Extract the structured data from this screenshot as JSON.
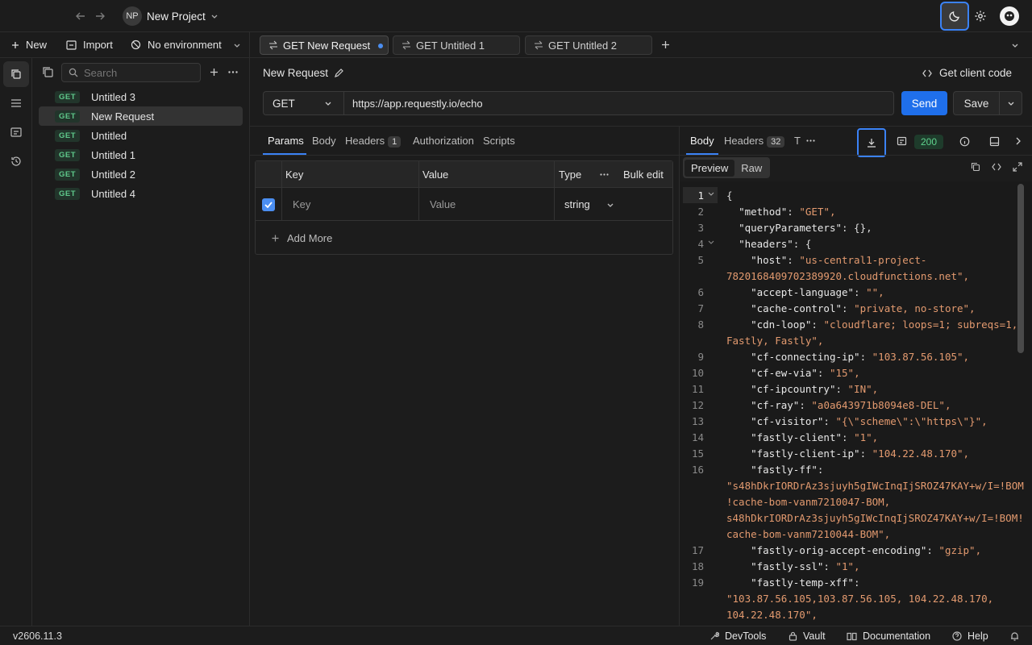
{
  "topbar": {
    "project_initials": "NP",
    "project_name": "New Project"
  },
  "toolbar": {
    "new_label": "New",
    "import_label": "Import",
    "environment_label": "No environment"
  },
  "tabs": [
    {
      "label": "GET New Request",
      "active": true,
      "unsaved": true
    },
    {
      "label": "GET Untitled 1",
      "active": false
    },
    {
      "label": "GET Untitled 2",
      "active": false
    }
  ],
  "sidebar": {
    "search_placeholder": "Search",
    "items": [
      {
        "method": "GET",
        "name": "Untitled 3"
      },
      {
        "method": "GET",
        "name": "New Request",
        "selected": true
      },
      {
        "method": "GET",
        "name": "Untitled"
      },
      {
        "method": "GET",
        "name": "Untitled 1"
      },
      {
        "method": "GET",
        "name": "Untitled 2"
      },
      {
        "method": "GET",
        "name": "Untitled 4"
      }
    ]
  },
  "request": {
    "name": "New Request",
    "client_code_label": "Get client code",
    "method": "GET",
    "url": "https://app.requestly.io/echo",
    "send_label": "Send",
    "save_label": "Save",
    "tabs": {
      "params": "Params",
      "body": "Body",
      "headers": "Headers",
      "headers_count": "1",
      "authorization": "Authorization",
      "scripts": "Scripts"
    },
    "params_table": {
      "col_key": "Key",
      "col_value": "Value",
      "col_type": "Type",
      "bulk_edit": "Bulk edit",
      "row_key_placeholder": "Key",
      "row_value_placeholder": "Value",
      "row_type": "string",
      "add_more": "Add More"
    }
  },
  "response": {
    "tab_body": "Body",
    "tab_headers": "Headers",
    "headers_count": "32",
    "tab_truncated": "T",
    "status": "200",
    "view_preview": "Preview",
    "view_raw": "Raw",
    "lines": [
      {
        "n": "1",
        "text": "{"
      },
      {
        "n": "2",
        "key": "\"method\"",
        "val": "\"GET\","
      },
      {
        "n": "3",
        "key": "\"queryParameters\"",
        "plain": ": {},"
      },
      {
        "n": "4",
        "key": "\"headers\"",
        "plain": ": {"
      },
      {
        "n": "5",
        "key": "\"host\"",
        "val": "\"us-central1-project-",
        "cont": "782016840970238992​0.cloudfunctions.net\","
      },
      {
        "n": "6",
        "key": "\"accept-language\"",
        "val": "\"\","
      },
      {
        "n": "7",
        "key": "\"cache-control\"",
        "val": "\"private, no-store\","
      },
      {
        "n": "8",
        "key": "\"cdn-loop\"",
        "val": "\"cloudflare; loops=1; subreqs=1,",
        "cont": "Fastly, Fastly\","
      },
      {
        "n": "9",
        "key": "\"cf-connecting-ip\"",
        "val": "\"103.87.56.105\","
      },
      {
        "n": "10",
        "key": "\"cf-ew-via\"",
        "val": "\"15\","
      },
      {
        "n": "11",
        "key": "\"cf-ipcountry\"",
        "val": "\"IN\","
      },
      {
        "n": "12",
        "key": "\"cf-ray\"",
        "val": "\"a0a643971b8094e8-DEL\","
      },
      {
        "n": "13",
        "key": "\"cf-visitor\"",
        "val": "\"{\\\"scheme\\\":\\\"https\\\"}\","
      },
      {
        "n": "14",
        "key": "\"fastly-client\"",
        "val": "\"1\","
      },
      {
        "n": "15",
        "key": "\"fastly-client-ip\"",
        "val": "\"104.22.48.170\","
      },
      {
        "n": "16",
        "key": "\"fastly-ff\"",
        "plain": ":"
      },
      {
        "n": "17",
        "key": "\"fastly-orig-accept-encoding\"",
        "val": "\"gzip\","
      },
      {
        "n": "18",
        "key": "\"fastly-ssl\"",
        "val": "\"1\","
      },
      {
        "n": "19",
        "key": "\"fastly-temp-xff\"",
        "plain": ":"
      }
    ],
    "fastly_ff_lines": [
      "\"s48hDkrIORDrAz3sjuyh5gIWcInqIjSROZ47KAY+w/I=!BOM",
      "!cache-bom-vanm7210047-BOM,",
      "s48hDkrIORDrAz3sjuyh5gIWcInqIjSROZ47KAY+w/I=!BOM!",
      "cache-bom-vanm7210044-BOM\","
    ],
    "xff_lines": [
      "\"103.87.56.105,103.87.56.105, 104.22.48.170,",
      "104.22.48.170\","
    ]
  },
  "footer": {
    "version": "v2606.11.3",
    "devtools": "DevTools",
    "vault": "Vault",
    "documentation": "Documentation",
    "help": "Help"
  }
}
